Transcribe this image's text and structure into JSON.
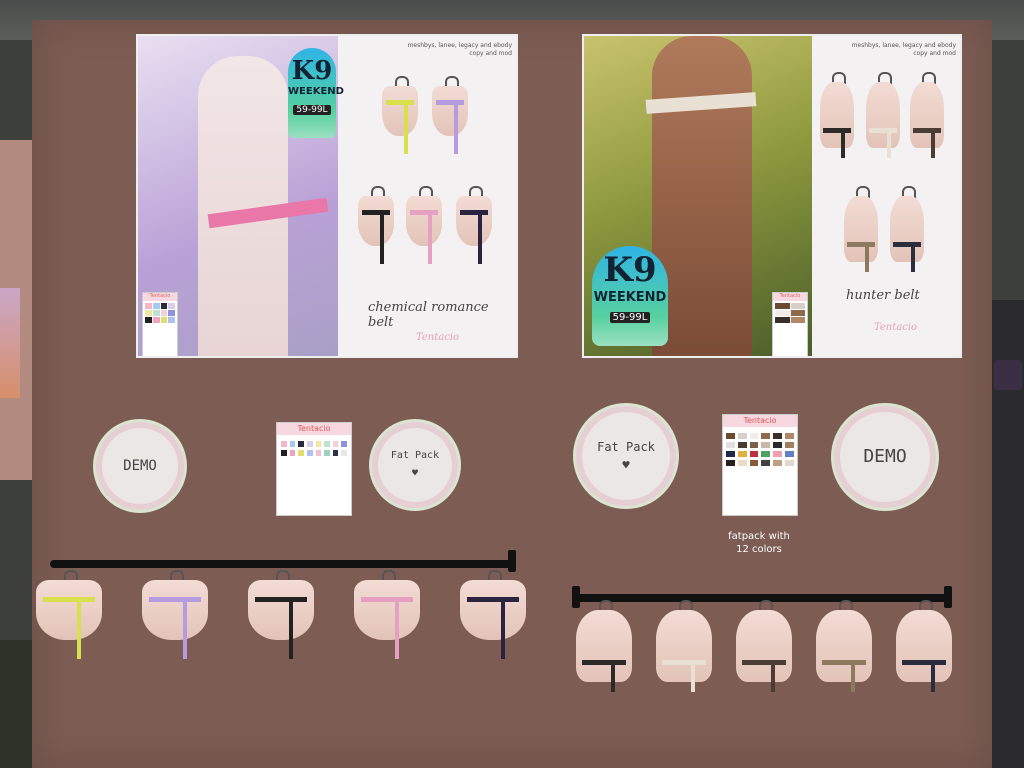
{
  "scene": {
    "wall_color": "#7c5c53"
  },
  "poster_left": {
    "badge": {
      "title": "K9",
      "subtitle": "WEEKEND",
      "price": "59-99L"
    },
    "hud_text": "meshbys, lanee, legacy and ebody\ncopy and mod",
    "belt_name": "chemical romance belt",
    "brand_sig": "Tentacio",
    "mini_card_title": "Tentacio"
  },
  "poster_right": {
    "badge": {
      "title": "K9",
      "subtitle": "WEEKEND",
      "price": "59-99L"
    },
    "hud_text": "meshbys, lanee, legacy and ebody\ncopy and mod",
    "belt_name": "hunter belt",
    "brand_sig": "Tentacio",
    "mini_card_title": "Tentacio"
  },
  "vendors_left": {
    "demo_label": "DEMO",
    "fatpack_label": "Fat Pack",
    "fatpack_heart": "♥",
    "card_title": "Tentacio"
  },
  "vendors_right": {
    "demo_label": "DEMO",
    "fatpack_label": "Fat Pack",
    "fatpack_heart": "♥",
    "card_title": "Tentacio",
    "fatpack_caption": "fatpack with\n12 colors"
  },
  "left_belt_colors": [
    "#d9e04d",
    "#b79be0",
    "#222222",
    "#e6a0c2",
    "#2a2440"
  ],
  "right_belt_colors": [
    "#2d2a2a",
    "#e8e0d2",
    "#4a3d33",
    "#8c7a5e",
    "#2b2f3d"
  ],
  "left_swatches": [
    "#f7b6c8",
    "#a7c8f0",
    "#2a2a3a",
    "#d8d0e8",
    "#f0e8a0",
    "#c0e0d0",
    "#f4d0d8",
    "#9090e0",
    "#202020",
    "#f0a0c0",
    "#e0e070",
    "#b0c0f0",
    "#f0c0d0",
    "#a0d0c0",
    "#303050",
    "#e8e8e8"
  ],
  "right_swatches": [
    "#6b4a32",
    "#d8d0c8",
    "#f0ece8",
    "#8c6a4a",
    "#3a2e28",
    "#b08868",
    "#e0e0e0",
    "#4a3a30",
    "#7a5e46",
    "#c8b8a8",
    "#2a2a2a",
    "#a08060",
    "#1d2a4a",
    "#e0b040",
    "#c03040",
    "#50a060",
    "#f0a0b0",
    "#6080c0",
    "#2a1e1a",
    "#e8dcc8",
    "#8a5a3a",
    "#404040",
    "#c0a080",
    "#e0d8d0"
  ]
}
